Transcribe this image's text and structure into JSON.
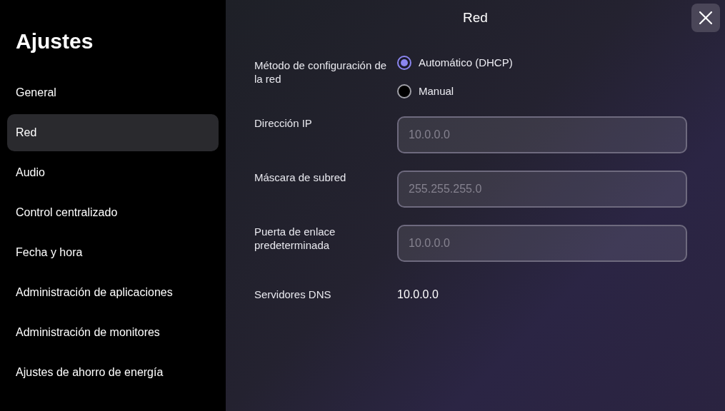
{
  "sidebar": {
    "title": "Ajustes",
    "items": [
      {
        "label": "General",
        "selected": false
      },
      {
        "label": "Red",
        "selected": true
      },
      {
        "label": "Audio",
        "selected": false
      },
      {
        "label": "Control centralizado",
        "selected": false
      },
      {
        "label": "Fecha y hora",
        "selected": false
      },
      {
        "label": "Administración de aplicaciones",
        "selected": false
      },
      {
        "label": "Administración de monitores",
        "selected": false
      },
      {
        "label": "Ajustes de ahorro de energía",
        "selected": false
      }
    ]
  },
  "panel": {
    "title": "Red",
    "rows": [
      {
        "kind": "radio",
        "label": "Método de configuración de la red",
        "options": [
          {
            "label": "Automático (DHCP)",
            "selected": true
          },
          {
            "label": "Manual",
            "selected": false
          }
        ]
      },
      {
        "kind": "field",
        "label": "Dirección IP",
        "value": "10.0.0.0",
        "disabled": true
      },
      {
        "kind": "field",
        "label": "Máscara de subred",
        "value": "255.255.255.0",
        "disabled": true
      },
      {
        "kind": "field",
        "label": "Puerta de enlace predeterminada",
        "value": "10.0.0.0",
        "disabled": true
      },
      {
        "kind": "text",
        "label": "Servidores DNS",
        "value": "10.0.0.0"
      }
    ]
  }
}
